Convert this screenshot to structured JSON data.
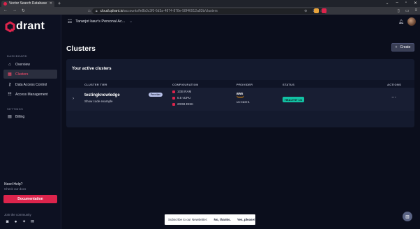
{
  "browser": {
    "tab_title": "Vector Search Database",
    "address_domain": "cloud.qdrant.io",
    "address_path": "/accounts/fe8b3c3f0-6d3a-4874-878e-58f46912a83b/clusters"
  },
  "sidebar": {
    "logo_text": "drant",
    "sections": [
      {
        "label": "DASHBOARD",
        "items": [
          {
            "label": "Overview",
            "icon": "home-icon",
            "active": false
          },
          {
            "label": "Clusters",
            "icon": "clusters-icon",
            "active": true
          },
          {
            "label": "Data Access Control",
            "icon": "key-icon",
            "active": false
          },
          {
            "label": "Access Management",
            "icon": "people-icon",
            "active": false
          }
        ]
      },
      {
        "label": "SETTINGS",
        "items": [
          {
            "label": "Billing",
            "icon": "billing-icon",
            "active": false
          }
        ]
      }
    ],
    "help": {
      "title": "Need Help?",
      "subtitle": "Check our docs",
      "button": "Documentation"
    },
    "community_label": "Join the community"
  },
  "header": {
    "org_name": "Taranjot kaur's Personal Ac...",
    "title": "Clusters",
    "create_label": "Create"
  },
  "panel": {
    "title": "Your active clusters",
    "columns": [
      "CLUSTER TIER",
      "CONFIGURATION",
      "PROVIDER",
      "STATUS",
      "ACTIONS"
    ],
    "cluster": {
      "name": "testingknowledge",
      "subtitle": "Show code example",
      "tier_badge": "Free tier",
      "config": [
        "1GB RAM",
        "0.5 vCPU",
        "20GB DISK"
      ],
      "provider": "aws",
      "region": "us-east-1",
      "status": "HEALTHY 1/1"
    }
  },
  "toast": {
    "message": "Subscribe to our Newsletter:",
    "no": "No, thanks.",
    "yes": "Yes, please!"
  },
  "colors": {
    "accent": "#dc244c",
    "healthy": "#12c1a4",
    "background": "#0b0e1c"
  }
}
